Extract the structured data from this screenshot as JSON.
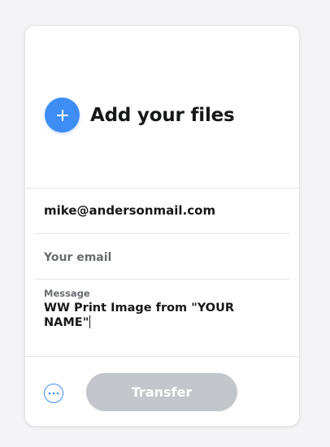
{
  "upload": {
    "title": "Add your files"
  },
  "form": {
    "to_email": "mike@andersonmail.com",
    "from_email_placeholder": "Your email",
    "message_label": "Message",
    "message_value": "WW Print Image from \"YOUR NAME\""
  },
  "actions": {
    "options_icon": "ellipsis-circle-icon",
    "transfer_label": "Transfer"
  },
  "colors": {
    "accent": "#3d8df5",
    "button_disabled": "#c3c6ca",
    "text_primary": "#17181a",
    "text_secondary": "#6a6d70",
    "background": "#f4f4f6"
  }
}
